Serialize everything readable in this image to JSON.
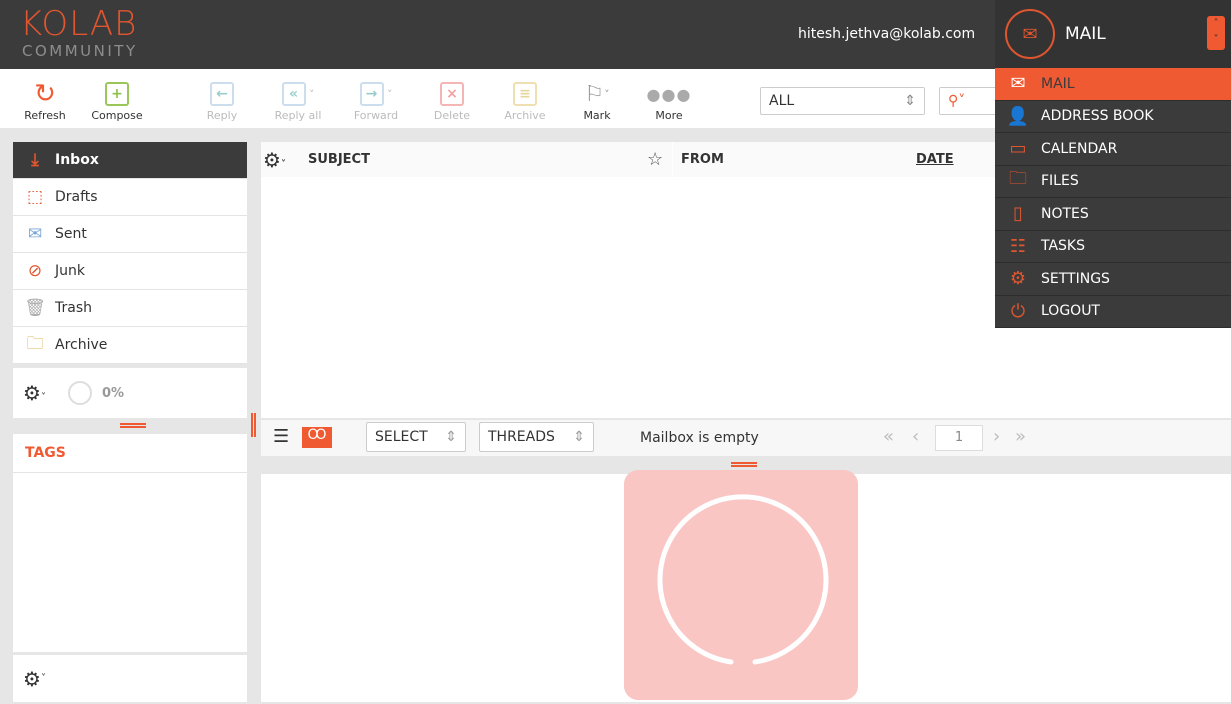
{
  "brand": {
    "line1": "KOLAB",
    "line2": "COMMUNITY"
  },
  "user": {
    "email": "hitesh.jethva@kolab.com"
  },
  "toolbar": {
    "refresh": "Refresh",
    "compose": "Compose",
    "reply": "Reply",
    "reply_all": "Reply all",
    "forward": "Forward",
    "delete": "Delete",
    "archive": "Archive",
    "mark": "Mark",
    "more": "More"
  },
  "filter": {
    "value": "ALL"
  },
  "folders": [
    {
      "label": "Inbox",
      "icon": "inbox-icon"
    },
    {
      "label": "Drafts",
      "icon": "drafts-icon"
    },
    {
      "label": "Sent",
      "icon": "sent-icon"
    },
    {
      "label": "Junk",
      "icon": "junk-icon"
    },
    {
      "label": "Trash",
      "icon": "trash-icon"
    },
    {
      "label": "Archive",
      "icon": "archive-icon"
    }
  ],
  "quota": {
    "text": "0%"
  },
  "tags": {
    "title": "TAGS"
  },
  "list": {
    "columns": {
      "subject": "SUBJECT",
      "from": "FROM",
      "date": "DATE"
    }
  },
  "footer": {
    "select": "SELECT",
    "threads": "THREADS",
    "status": "Mailbox is empty",
    "page": "1"
  },
  "app_menu": {
    "current": "MAIL",
    "items": [
      "MAIL",
      "ADDRESS BOOK",
      "CALENDAR",
      "FILES",
      "NOTES",
      "TASKS",
      "SETTINGS",
      "LOGOUT"
    ]
  },
  "colors": {
    "accent": "#f05a32",
    "header": "#3c3b3b"
  }
}
